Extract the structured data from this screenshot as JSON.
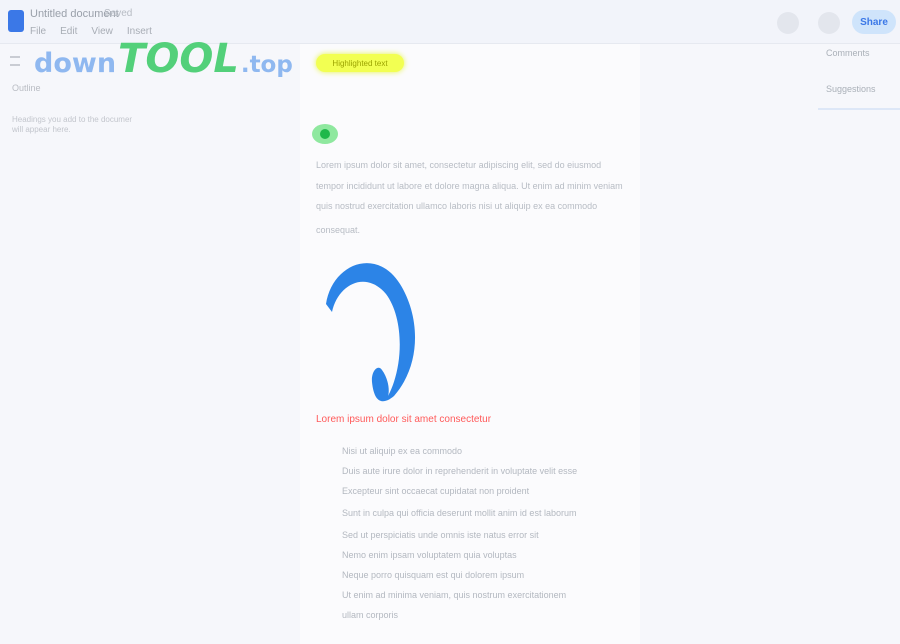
{
  "window": {
    "title": "Untitled document",
    "subtitle": "Saved",
    "menu": [
      "File",
      "Edit",
      "View",
      "Insert"
    ]
  },
  "toolbar": {
    "share_label": "Share"
  },
  "watermark": {
    "part1": "down",
    "part2": "TOOL",
    "part3": ".top"
  },
  "left_panel": {
    "heading": "Outline",
    "item_1": "Headings you add to the document",
    "item_2": "will appear here."
  },
  "right_panel": {
    "item_1": "Comments",
    "item_2": "Suggestions"
  },
  "document": {
    "highlight": "Highlighted text",
    "paragraph": [
      "Lorem ipsum dolor sit amet, consectetur adipiscing elit, sed do eiusmod",
      "tempor incididunt ut labore et dolore magna aliqua. Ut enim ad minim veniam",
      "quis nostrud exercitation ullamco laboris nisi ut aliquip ex ea commodo",
      "consequat."
    ],
    "red_note": "Lorem ipsum dolor sit amet consectetur",
    "bullets": [
      "Nisi ut aliquip ex ea commodo",
      "Duis aute irure dolor in reprehenderit in voluptate velit esse",
      "Excepteur sint occaecat cupidatat non proident",
      "Sunt in culpa qui officia deserunt mollit anim id est laborum",
      "Sed ut perspiciatis unde omnis iste natus error sit",
      "Nemo enim ipsam voluptatem quia voluptas",
      "Neque porro quisquam est qui dolorem ipsum",
      "Ut enim ad minima veniam, quis nostrum exercitationem",
      "ullam corporis"
    ]
  },
  "colors": {
    "highlight_yellow": "#f2ff52",
    "green_dot": "#1fb84a",
    "red_text": "#ff5a5a",
    "brand_blue": "#3b78e7"
  }
}
